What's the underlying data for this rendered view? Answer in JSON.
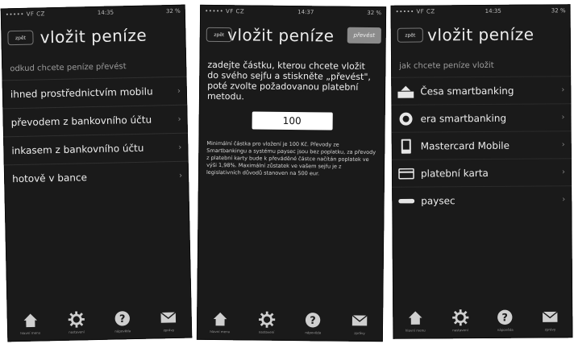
{
  "status_left": "••••• VF CZ",
  "screens": [
    {
      "time": "14:35",
      "battery": "32 %",
      "back": "zpět",
      "title": "vložit peníze",
      "prompt": "odkud chcete peníze převést",
      "items": [
        "ihned prostřednictvím mobilu",
        "převodem z bankovního účtu",
        "inkasem z bankovního účtu",
        "hotově v bance"
      ]
    },
    {
      "time": "14:37",
      "battery": "32 %",
      "back": "zpět",
      "title": "vložit peníze",
      "action": "převést",
      "instruction": "zadejte částku, kterou chcete vložit do svého sejfu a stiskněte „převést\", poté zvolte požadovanou platební metodu.",
      "amount": "100",
      "note": "Minimální částka pro vložení je 100 Kč. Převody ze Smartbankingu a systému paysec jsou bez poplatku, za převody z platební karty bude k převáděné částce načítán poplatek ve výši 1,98%. Maximální zůstatek ve vašem sejfu je z legislativních důvodů stanoven na 500 eur."
    },
    {
      "time": "14:35",
      "battery": "32 %",
      "back": "zpět",
      "title": "vložit peníze",
      "prompt": "jak chcete peníze vložit",
      "methods": [
        {
          "label": "Česa smartbanking",
          "icon": "csob-logo-icon"
        },
        {
          "label": "era smartbanking",
          "icon": "era-logo-icon"
        },
        {
          "label": "Mastercard Mobile",
          "icon": "mastercard-mobile-icon"
        },
        {
          "label": "platební karta",
          "icon": "payment-card-icon"
        },
        {
          "label": "paysec",
          "icon": "paysec-logo-icon"
        }
      ]
    }
  ],
  "tabs": [
    {
      "label": "hlavní menu",
      "icon": "home-icon"
    },
    {
      "label": "nastavení",
      "icon": "gear-icon"
    },
    {
      "label": "nápověda",
      "icon": "help-icon"
    },
    {
      "label": "zprávy",
      "icon": "mail-icon"
    }
  ]
}
